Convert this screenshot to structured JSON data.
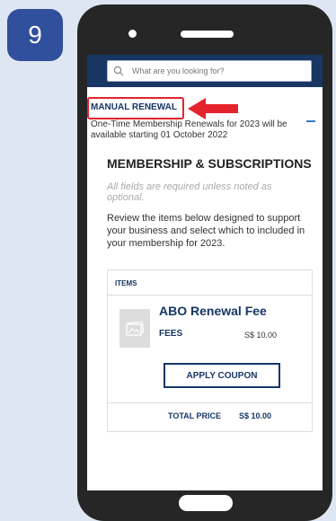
{
  "step": {
    "number": "9"
  },
  "search": {
    "placeholder": "What are you looking for?"
  },
  "renewal": {
    "section_label": "MANUAL RENEWAL",
    "description": "One-Time Membership Renewals for 2023 will be available starting  01 October 2022"
  },
  "membership": {
    "title": "MEMBERSHIP & SUBSCRIPTIONS",
    "optional_note": "All fields are required unless noted as optional.",
    "review_text": "Review the items below designed to support your business and select which to included in your membership for 2023."
  },
  "items": {
    "header": "ITEMS",
    "product": {
      "name": "ABO Renewal Fee",
      "fee_label": "FEES",
      "fee_value": "S$ 10.00"
    },
    "apply_coupon_label": "APPLY COUPON",
    "total_label": "TOTAL PRICE",
    "total_value": "S$ 10.00"
  },
  "colors": {
    "navy": "#173664",
    "highlight_red": "#e4232c",
    "badge_blue": "#304f9c",
    "accent_blue": "#3a78c9"
  },
  "icons": [
    "search-icon",
    "image-placeholder-icon",
    "red-arrow-icon",
    "collapse-minus-icon"
  ]
}
